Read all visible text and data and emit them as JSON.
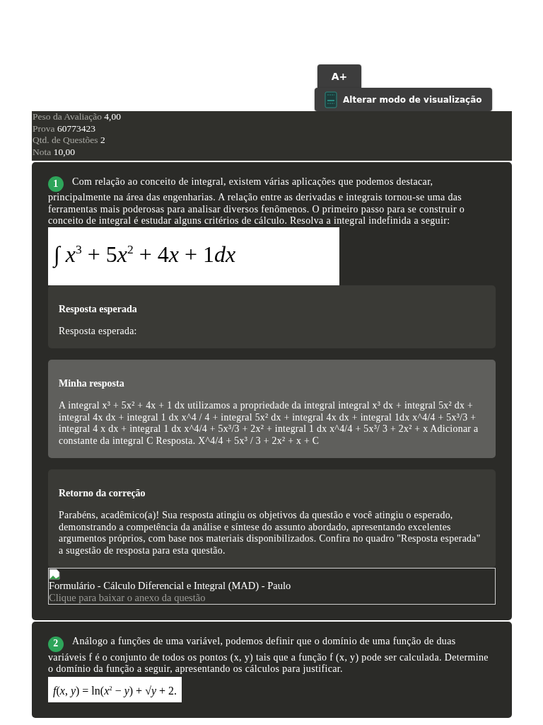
{
  "toolbar": {
    "font_button": "A+",
    "view_mode_button": "Alterar modo de visualização"
  },
  "summary": [
    {
      "label": "Peso da Avaliação",
      "value": "4,00"
    },
    {
      "label": "Prova",
      "value": "60773423"
    },
    {
      "label": "Qtd. de Questões",
      "value": "2"
    },
    {
      "label": "Nota",
      "value": "10,00"
    }
  ],
  "questions": [
    {
      "number": "1",
      "statement": "Com relação ao conceito de integral, existem várias aplicações que podemos destacar, principalmente na área das engenharias. A relação entre as derivadas e integrais tornou-se uma das ferramentas mais poderosas para analisar diversos fenômenos. O primeiro passo para se construir o conceito de integral é estudar alguns critérios de cálculo. Resolva a integral indefinida a seguir:",
      "formula": {
        "kind": "large",
        "parts": [
          {
            "text": "∫ ",
            "kind": "roman"
          },
          {
            "text": "x",
            "kind": "italic"
          },
          {
            "text": "3",
            "kind": "sup"
          },
          {
            "text": " + 5",
            "kind": "roman"
          },
          {
            "text": "x",
            "kind": "italic"
          },
          {
            "text": "2",
            "kind": "sup"
          },
          {
            "text": " + 4",
            "kind": "roman"
          },
          {
            "text": "x",
            "kind": "italic"
          },
          {
            "text": " + 1",
            "kind": "roman"
          },
          {
            "text": "dx",
            "kind": "italic"
          }
        ]
      },
      "sections": [
        {
          "kind": "expected",
          "title": "Resposta esperada",
          "body": "Resposta esperada:"
        },
        {
          "kind": "mine",
          "title": "Minha resposta",
          "body": "A integral x³ + 5x² + 4x + 1 dx utilizamos a propriedade da integral integral x³ dx + integral 5x² dx + integral 4x dx + integral 1 dx x^4 / 4 + integral 5x² dx + integral 4x dx + integral 1dx x^4/4 + 5x³/3 + integral 4 x dx + integral 1 dx x^4/4 + 5x³/3 + 2x² + integral 1 dx x^4/4 + 5x³/ 3 + 2x² + x Adicionar a constante da integral C Resposta. X^4/4 + 5x³ / 3 + 2x² + x + C"
        },
        {
          "kind": "feedback",
          "title": "Retorno da correção",
          "body": "Parabéns, acadêmico(a)! Sua resposta atingiu os objetivos da questão e você atingiu o esperado, demonstrando a competência da análise e síntese do assunto abordado, apresentando excelentes argumentos próprios, com base nos materiais disponibilizados. Confira no quadro \"Resposta esperada\" a sugestão de resposta para esta questão."
        }
      ],
      "attachment": {
        "title": "Formulário - Cálculo Diferencial e Integral (MAD) - Paulo",
        "link": "Clique para baixar o anexo da questão"
      }
    },
    {
      "number": "2",
      "statement": "Análogo a funções de uma variável, podemos definir que o domínio de uma função de duas variáveis f é o conjunto de todos os pontos (x, y) tais que a função f (x, y) pode ser calculada. Determine o domínio da função a seguir, apresentando os cálculos para justificar.",
      "formula": {
        "kind": "small",
        "parts": [
          {
            "text": "f",
            "kind": "italic"
          },
          {
            "text": "(",
            "kind": "roman"
          },
          {
            "text": "x",
            "kind": "italic"
          },
          {
            "text": ", ",
            "kind": "roman"
          },
          {
            "text": "y",
            "kind": "italic"
          },
          {
            "text": ") = ln(",
            "kind": "roman"
          },
          {
            "text": "x",
            "kind": "italic"
          },
          {
            "text": "2",
            "kind": "sup"
          },
          {
            "text": " − ",
            "kind": "roman"
          },
          {
            "text": "y",
            "kind": "italic"
          },
          {
            "text": ") + √",
            "kind": "roman"
          },
          {
            "text": "y",
            "kind": "italic"
          },
          {
            "text": " + 2.",
            "kind": "roman"
          }
        ]
      }
    }
  ]
}
